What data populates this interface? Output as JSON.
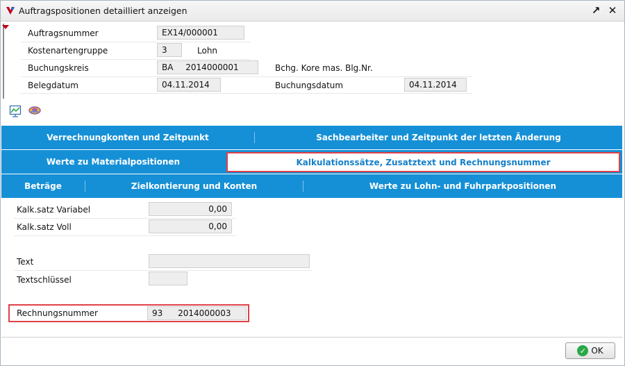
{
  "window": {
    "title": "Auftragspositionen detailliert anzeigen",
    "expand_glyph": "↗",
    "close_glyph": "✕"
  },
  "header": {
    "auftragsnummer_label": "Auftragsnummer",
    "auftragsnummer_value": "EX14/000001",
    "kostenartengruppe_label": "Kostenartengruppe",
    "kostenartengruppe_value": "3",
    "kostenartengruppe_text": "Lohn",
    "buchungskreis_label": "Buchungskreis",
    "buchungskreis_code": "BA",
    "buchungskreis_number": "2014000001",
    "bchg_label": "Bchg. Kore mas. Blg.Nr.",
    "belegdatum_label": "Belegdatum",
    "belegdatum_value": "04.11.2014",
    "buchungsdatum_label": "Buchungsdatum",
    "buchungsdatum_value": "04.11.2014"
  },
  "toolbar": {
    "icons": [
      "chart-icon",
      "tools-icon"
    ]
  },
  "tabs": {
    "row1": [
      "Verrechnungkonten und Zeitpunkt",
      "Sachbearbeiter und Zeitpunkt der letzten Änderung"
    ],
    "row2": [
      "Werte zu Materialpositionen",
      "Kalkulationssätze, Zusatztext und Rechnungsnummer"
    ],
    "row3": [
      "Beträge",
      "Zielkontierung und Konten",
      "Werte zu Lohn- und Fuhrparkpositionen"
    ],
    "active": "Kalkulationssätze, Zusatztext und Rechnungsnummer"
  },
  "content": {
    "kalk_variabel_label": "Kalk.satz Variabel",
    "kalk_variabel_value": "0,00",
    "kalk_voll_label": "Kalk.satz Voll",
    "kalk_voll_value": "0,00",
    "text_label": "Text",
    "text_value": "",
    "textschluessel_label": "Textschlüssel",
    "textschluessel_value": "",
    "rechnungsnummer_label": "Rechnungsnummer",
    "rechnungsnummer_code": "93",
    "rechnungsnummer_number": "2014000003"
  },
  "footer": {
    "ok_label": "OK"
  },
  "colors": {
    "tab_blue": "#1590d6",
    "highlight_red": "#e04048",
    "active_tab_text": "#1580c8"
  }
}
